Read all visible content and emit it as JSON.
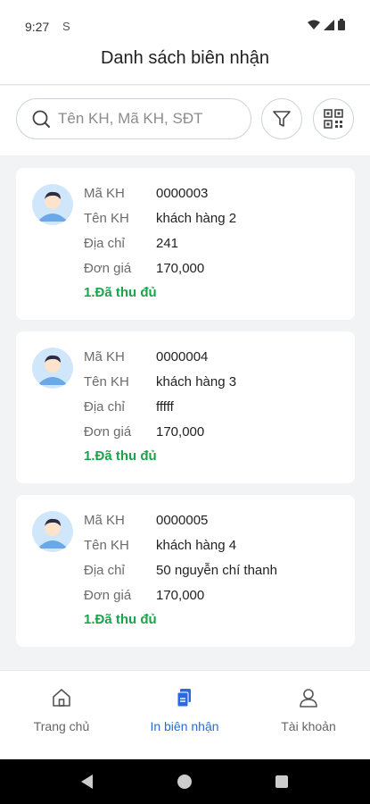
{
  "statusbar": {
    "time": "9:27",
    "sim_glyph": "S"
  },
  "header": {
    "title": "Danh sách biên nhận"
  },
  "search": {
    "placeholder": "Tên KH, Mã KH, SĐT",
    "value": ""
  },
  "labels": {
    "code": "Mã KH",
    "name": "Tên KH",
    "address": "Địa chỉ",
    "price": "Đơn giá"
  },
  "receipts": [
    {
      "code": "0000003",
      "name": "khách hàng 2",
      "address": "241",
      "price": "170,000",
      "status": "1.Đã thu đủ"
    },
    {
      "code": "0000004",
      "name": "khách hàng 3",
      "address": "fffff",
      "price": "170,000",
      "status": "1.Đã thu đủ"
    },
    {
      "code": "0000005",
      "name": "khách hàng 4",
      "address": "50 nguyễn chí thanh",
      "price": "170,000",
      "status": "1.Đã thu đủ"
    }
  ],
  "nav": {
    "items": [
      {
        "label": "Trang chủ",
        "icon": "home-icon"
      },
      {
        "label": "In biên nhận",
        "icon": "receipt-icon",
        "active": true
      },
      {
        "label": "Tài khoản",
        "icon": "user-icon"
      }
    ]
  },
  "colors": {
    "accent": "#2a6ae0",
    "status_paid": "#1aa34a",
    "avatar_bg": "#cfe6fb"
  }
}
